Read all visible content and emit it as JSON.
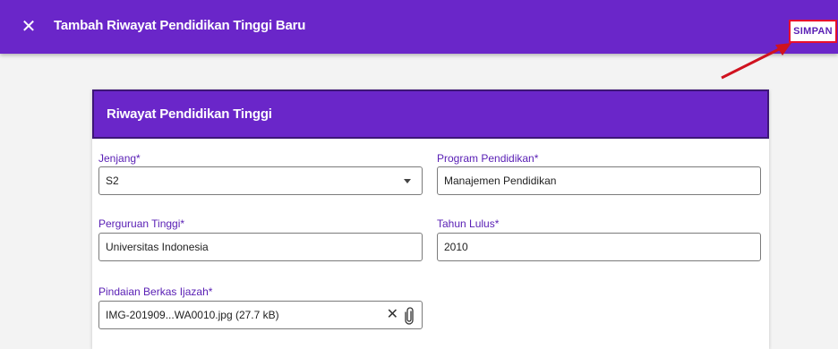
{
  "appbar": {
    "close_glyph": "✕",
    "title": "Tambah Riwayat Pendidikan Tinggi Baru",
    "save_label": "SIMPAN"
  },
  "card": {
    "title": "Riwayat Pendidikan Tinggi"
  },
  "form": {
    "jenjang": {
      "label": "Jenjang*",
      "value": "S2"
    },
    "program": {
      "label": "Program Pendidikan*",
      "value": "Manajemen Pendidikan"
    },
    "perguruan": {
      "label": "Perguruan Tinggi*",
      "value": "Universitas Indonesia"
    },
    "tahun": {
      "label": "Tahun Lulus*",
      "value": "2010"
    },
    "berkas": {
      "label": "Pindaian Berkas Ijazah*",
      "value": "IMG-201909...WA0010.jpg (27.7 kB)",
      "clear_glyph": "✕"
    }
  },
  "colors": {
    "appbar": "#6a26c9",
    "label": "#5a20b5",
    "highlight": "#e8102c"
  },
  "icons": {
    "close": "close-icon",
    "caret": "caret-down-icon",
    "clear": "clear-icon",
    "attach": "paperclip-icon"
  }
}
